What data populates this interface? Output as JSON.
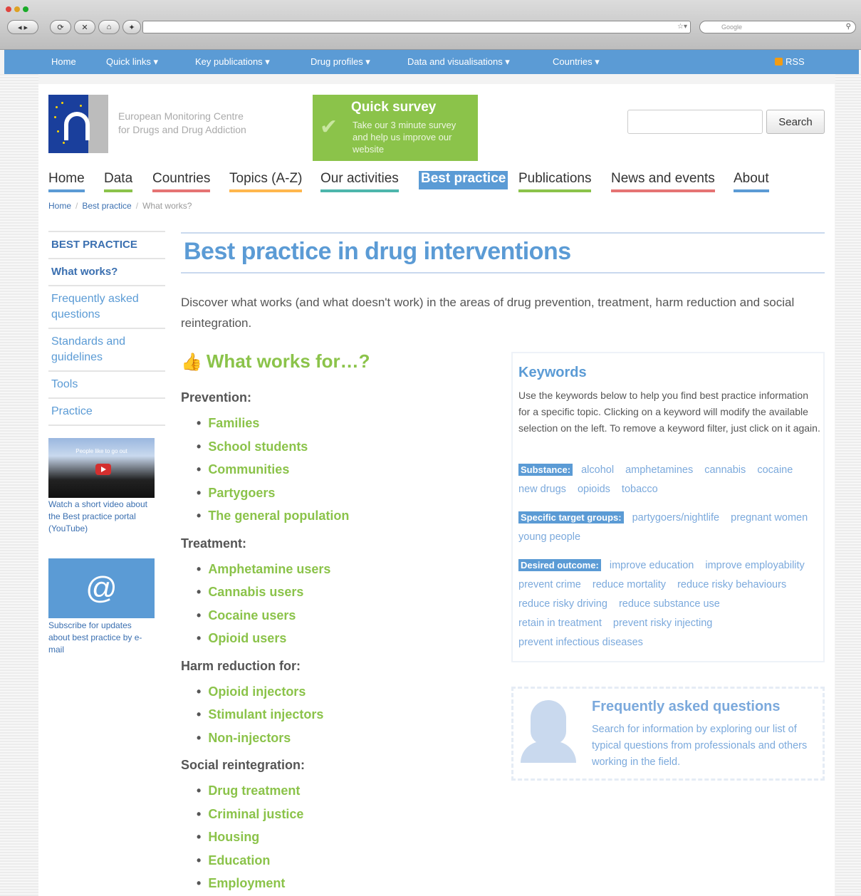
{
  "browser": {
    "google_placeholder": "Google"
  },
  "topnav": {
    "items": [
      "Home",
      "Quick links ▾",
      "Key publications ▾",
      "Drug profiles ▾",
      "Data and visualisations ▾",
      "Countries ▾"
    ],
    "rss": "RSS"
  },
  "header": {
    "org_name": "European Monitoring Centre\nfor Drugs and Drug Addiction",
    "survey_title": "Quick survey",
    "survey_desc": "Take our 3 minute survey and help us improve our website",
    "search_button": "Search"
  },
  "mainnav": {
    "items": [
      "Home",
      "Data",
      "Countries",
      "Topics (A-Z)",
      "Our activities",
      "Best practice",
      "Publications",
      "News and events",
      "About"
    ]
  },
  "breadcrumb": {
    "home": "Home",
    "section": "Best practice",
    "current": "What works?"
  },
  "sidebar": {
    "heading": "BEST PRACTICE",
    "items": [
      "What works?",
      "Frequently asked questions",
      "Standards and guidelines",
      "Tools",
      "Practice"
    ],
    "video_caption": "People like to go out",
    "video_text": "Watch a short video about the Best practice portal (YouTube)",
    "email_icon": "@",
    "email_text": "Subscribe for updates about best practice by e-mail"
  },
  "main": {
    "title": "Best practice in drug interventions",
    "intro": "Discover what works (and what doesn't work) in the areas of drug prevention, treatment, harm reduction and social reintegration.",
    "what_works_title": "What works for…?",
    "groups": [
      {
        "label": "Prevention:",
        "items": [
          "Families",
          "School students",
          "Communities",
          "Partygoers",
          "The general population"
        ]
      },
      {
        "label": "Treatment:",
        "items": [
          "Amphetamine users",
          "Cannabis users",
          "Cocaine users",
          "Opioid users"
        ]
      },
      {
        "label": "Harm reduction for:",
        "items": [
          "Opioid injectors",
          "Stimulant injectors",
          "Non-injectors"
        ]
      },
      {
        "label": "Social reintegration:",
        "items": [
          "Drug treatment",
          "Criminal justice",
          "Housing",
          "Education",
          "Employment"
        ]
      }
    ]
  },
  "keywords": {
    "title": "Keywords",
    "desc": "Use the keywords below to help you find best practice information for a specific topic. Clicking on a keyword will modify the available selection on the left. To remove a keyword filter, just click on it again.",
    "substance_label": "Substance:",
    "substance": [
      "alcohol",
      "amphetamines",
      "cannabis",
      "cocaine",
      "new drugs",
      "opioids",
      "tobacco"
    ],
    "target_label": "Specific target groups:",
    "target": [
      "partygoers/nightlife",
      "pregnant women",
      "young people"
    ],
    "outcome_label": "Desired outcome:",
    "outcome": [
      "improve education",
      "improve employability",
      "prevent crime",
      "reduce mortality",
      "reduce risky behaviours",
      "reduce risky driving",
      "reduce substance use",
      "retain in treatment",
      "prevent risky injecting",
      "prevent infectious diseases"
    ]
  },
  "faq": {
    "title": "Frequently asked questions",
    "desc": "Search for information by exploring our list of typical questions from professionals and others working in the field."
  },
  "colors": {
    "brand_blue": "#5b9bd5",
    "brand_green": "#8bc34a"
  }
}
